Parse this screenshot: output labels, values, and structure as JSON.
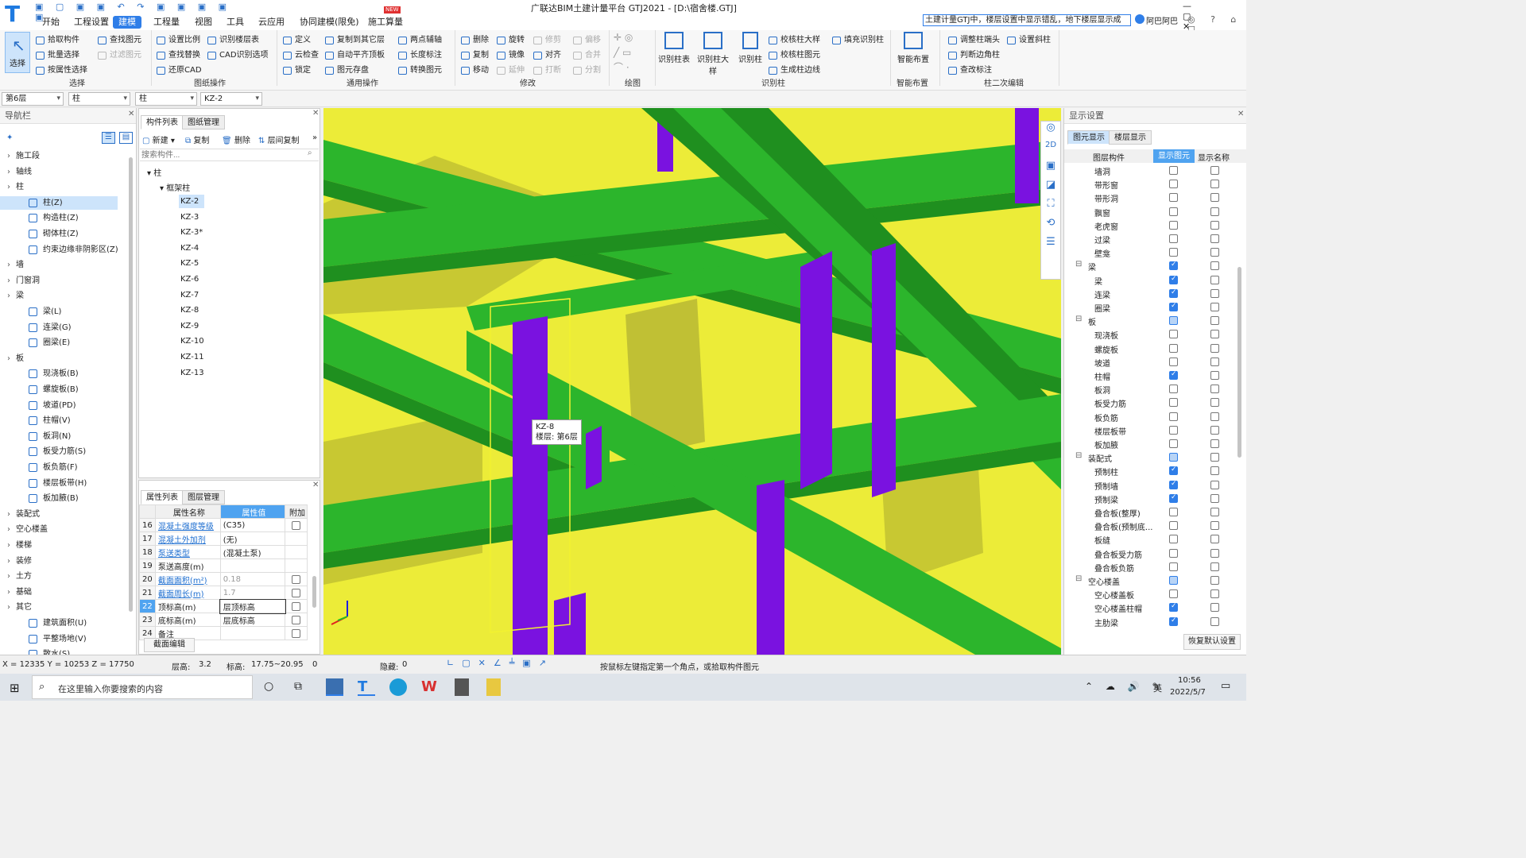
{
  "app": {
    "title": "广联达BIM土建计量平台 GTJ2021 - [D:\\宿舍楼.GTJ]",
    "logo_letter": "T",
    "new_badge": "NEW",
    "help_search": "土建计量GTJ中，楼层设置中显示错乱，地下楼层显示成",
    "user": "阿巴阿巴"
  },
  "menu_tabs": [
    "开始",
    "工程设置",
    "建模",
    "工程量",
    "视图",
    "工具",
    "云应用",
    "协同建模(限免)",
    "施工算量"
  ],
  "ribbon": {
    "select_big": "选择",
    "select_group": {
      "items": [
        "拾取构件",
        "批量选择",
        "按属性选择",
        "查找图元",
        "过滤图元"
      ],
      "label": "选择"
    },
    "drawing_ops": {
      "items": [
        "设置比例",
        "查找替换",
        "还原CAD",
        "识别楼层表",
        "CAD识别选项"
      ],
      "label": "图纸操作"
    },
    "common_ops": {
      "items": [
        "定义",
        "云检查",
        "锁定",
        "复制到其它层",
        "自动平齐顶板",
        "图元存盘",
        "两点辅轴",
        "长度标注",
        "转换图元"
      ],
      "label": "通用操作"
    },
    "modify": {
      "items": [
        "删除",
        "旋转",
        "修剪",
        "偏移",
        "复制",
        "镜像",
        "对齐",
        "合并",
        "移动",
        "延伸",
        "打断",
        "分割"
      ],
      "label": "修改"
    },
    "draw": {
      "label": "绘图"
    },
    "identify_col": {
      "bigs": [
        "识别柱表",
        "识别柱大样",
        "识别柱"
      ],
      "items": [
        "校核柱大样",
        "填充识别柱",
        "校核柱图元",
        "生成柱边线"
      ],
      "label": "识别柱"
    },
    "smart": {
      "big": "智能布置",
      "label": "智能布置"
    },
    "col_edit": {
      "items": [
        "调整柱端头",
        "设置斜柱",
        "判断边角柱",
        "查改标注"
      ],
      "label": "柱二次编辑"
    }
  },
  "filters": {
    "floor": "第6层",
    "type1": "柱",
    "type2": "柱",
    "component": "KZ-2"
  },
  "nav": {
    "title": "导航栏",
    "tree": [
      {
        "kind": "cat",
        "label": "施工段"
      },
      {
        "kind": "cat",
        "label": "轴线"
      },
      {
        "kind": "cat",
        "label": "柱"
      },
      {
        "kind": "item",
        "label": "柱(Z)",
        "selected": true
      },
      {
        "kind": "item",
        "label": "构造柱(Z)"
      },
      {
        "kind": "item",
        "label": "砌体柱(Z)"
      },
      {
        "kind": "item",
        "label": "约束边缘非阴影区(Z)"
      },
      {
        "kind": "cat",
        "label": "墙"
      },
      {
        "kind": "cat",
        "label": "门窗洞"
      },
      {
        "kind": "cat",
        "label": "梁"
      },
      {
        "kind": "item",
        "label": "梁(L)"
      },
      {
        "kind": "item",
        "label": "连梁(G)"
      },
      {
        "kind": "item",
        "label": "圈梁(E)"
      },
      {
        "kind": "cat",
        "label": "板"
      },
      {
        "kind": "item",
        "label": "现浇板(B)"
      },
      {
        "kind": "item",
        "label": "螺旋板(B)"
      },
      {
        "kind": "item",
        "label": "坡道(PD)"
      },
      {
        "kind": "item",
        "label": "柱帽(V)"
      },
      {
        "kind": "item",
        "label": "板洞(N)"
      },
      {
        "kind": "item",
        "label": "板受力筋(S)"
      },
      {
        "kind": "item",
        "label": "板负筋(F)"
      },
      {
        "kind": "item",
        "label": "楼层板带(H)"
      },
      {
        "kind": "item",
        "label": "板加腋(B)"
      },
      {
        "kind": "cat",
        "label": "装配式"
      },
      {
        "kind": "cat",
        "label": "空心楼盖"
      },
      {
        "kind": "cat",
        "label": "楼梯"
      },
      {
        "kind": "cat",
        "label": "装修"
      },
      {
        "kind": "cat",
        "label": "土方"
      },
      {
        "kind": "cat",
        "label": "基础"
      },
      {
        "kind": "cat",
        "label": "其它"
      },
      {
        "kind": "item",
        "label": "建筑面积(U)"
      },
      {
        "kind": "item",
        "label": "平整场地(V)"
      },
      {
        "kind": "item",
        "label": "散水(S)"
      }
    ]
  },
  "components": {
    "tabs": [
      "构件列表",
      "图纸管理"
    ],
    "toolbar": [
      "新建",
      "复制",
      "删除",
      "层间复制"
    ],
    "search_placeholder": "搜索构件...",
    "root": "柱",
    "group": "框架柱",
    "items": [
      "KZ-2",
      "KZ-3",
      "KZ-3*",
      "KZ-4",
      "KZ-5",
      "KZ-6",
      "KZ-7",
      "KZ-8",
      "KZ-9",
      "KZ-10",
      "KZ-11",
      "KZ-13"
    ],
    "selected": "KZ-2"
  },
  "properties": {
    "tabs": [
      "属性列表",
      "图层管理"
    ],
    "headers": [
      "属性名称",
      "属性值",
      "附加"
    ],
    "rows": [
      {
        "no": "16",
        "name": "混凝土强度等级",
        "value": "(C35)",
        "blue": true,
        "cb": true
      },
      {
        "no": "17",
        "name": "混凝土外加剂",
        "value": "(无)",
        "blue": true,
        "cb": false
      },
      {
        "no": "18",
        "name": "泵送类型",
        "value": "(混凝土泵)",
        "blue": true,
        "cb": false
      },
      {
        "no": "19",
        "name": "泵送高度(m)",
        "value": "",
        "blue": false,
        "cb": false
      },
      {
        "no": "20",
        "name": "截面面积(m²)",
        "value": "0.18",
        "blue": true,
        "cb": true,
        "gray": true
      },
      {
        "no": "21",
        "name": "截面周长(m)",
        "value": "1.7",
        "blue": true,
        "cb": true,
        "gray": true
      },
      {
        "no": "22",
        "name": "顶标高(m)",
        "value": "层顶标高",
        "blue": false,
        "cb": true,
        "active": true
      },
      {
        "no": "23",
        "name": "底标高(m)",
        "value": "层底标高",
        "blue": false,
        "cb": true
      },
      {
        "no": "24",
        "name": "备注",
        "value": "",
        "blue": false,
        "cb": true
      }
    ],
    "button": "截面编辑"
  },
  "viewport": {
    "tooltip": [
      "KZ-8",
      "楼层: 第6层"
    ],
    "colors": {
      "slab": "#ecec38",
      "beam": "#2cb52c",
      "beam_dark": "#1f8f1f",
      "column": "#7a12e0",
      "wall": "#c8c832"
    }
  },
  "display": {
    "title": "显示设置",
    "tabs": [
      "图元显示",
      "楼层显示"
    ],
    "headers": [
      "图层构件",
      "显示图元",
      "显示名称"
    ],
    "rows": [
      {
        "l": "墙洞",
        "lv": 2,
        "a": 0,
        "b": 0
      },
      {
        "l": "带形窗",
        "lv": 2,
        "a": 0,
        "b": 0
      },
      {
        "l": "带形洞",
        "lv": 2,
        "a": 0,
        "b": 0
      },
      {
        "l": "飘窗",
        "lv": 2,
        "a": 0,
        "b": 0
      },
      {
        "l": "老虎窗",
        "lv": 2,
        "a": 0,
        "b": 0
      },
      {
        "l": "过梁",
        "lv": 2,
        "a": 0,
        "b": 0
      },
      {
        "l": "壁龛",
        "lv": 2,
        "a": 0,
        "b": 0
      },
      {
        "l": "梁",
        "lv": 1,
        "a": 1,
        "b": 0
      },
      {
        "l": "梁",
        "lv": 2,
        "a": 1,
        "b": 0
      },
      {
        "l": "连梁",
        "lv": 2,
        "a": 1,
        "b": 0
      },
      {
        "l": "圈梁",
        "lv": 2,
        "a": 1,
        "b": 0
      },
      {
        "l": "板",
        "lv": 1,
        "a": 2,
        "b": 0
      },
      {
        "l": "现浇板",
        "lv": 2,
        "a": 0,
        "b": 0
      },
      {
        "l": "螺旋板",
        "lv": 2,
        "a": 0,
        "b": 0
      },
      {
        "l": "坡道",
        "lv": 2,
        "a": 0,
        "b": 0
      },
      {
        "l": "柱帽",
        "lv": 2,
        "a": 1,
        "b": 0
      },
      {
        "l": "板洞",
        "lv": 2,
        "a": 0,
        "b": 0
      },
      {
        "l": "板受力筋",
        "lv": 2,
        "a": 0,
        "b": 0
      },
      {
        "l": "板负筋",
        "lv": 2,
        "a": 0,
        "b": 0
      },
      {
        "l": "楼层板带",
        "lv": 2,
        "a": 0,
        "b": 0
      },
      {
        "l": "板加腋",
        "lv": 2,
        "a": 0,
        "b": 0
      },
      {
        "l": "装配式",
        "lv": 1,
        "a": 2,
        "b": 0
      },
      {
        "l": "预制柱",
        "lv": 2,
        "a": 1,
        "b": 0
      },
      {
        "l": "预制墙",
        "lv": 2,
        "a": 1,
        "b": 0
      },
      {
        "l": "预制梁",
        "lv": 2,
        "a": 1,
        "b": 0
      },
      {
        "l": "叠合板(整厚)",
        "lv": 2,
        "a": 0,
        "b": 0
      },
      {
        "l": "叠合板(预制底...",
        "lv": 2,
        "a": 0,
        "b": 0
      },
      {
        "l": "板缝",
        "lv": 2,
        "a": 0,
        "b": 0
      },
      {
        "l": "叠合板受力筋",
        "lv": 2,
        "a": 0,
        "b": 0
      },
      {
        "l": "叠合板负筋",
        "lv": 2,
        "a": 0,
        "b": 0
      },
      {
        "l": "空心楼盖",
        "lv": 1,
        "a": 2,
        "b": 0
      },
      {
        "l": "空心楼盖板",
        "lv": 2,
        "a": 0,
        "b": 0
      },
      {
        "l": "空心楼盖柱帽",
        "lv": 2,
        "a": 1,
        "b": 0
      },
      {
        "l": "主肋梁",
        "lv": 2,
        "a": 1,
        "b": 0
      }
    ],
    "button": "恢复默认设置"
  },
  "status": {
    "coords": "X = 12335 Y = 10253 Z = 17750",
    "floor_height_label": "层高:",
    "floor_height": "3.2",
    "elev_label": "标高:",
    "elev": "17.75~20.95",
    "zero": "0",
    "hidden_label": "隐藏:",
    "hidden": "0",
    "hint": "按鼠标左键指定第一个角点，或拾取构件图元"
  },
  "taskbar": {
    "search": "在这里输入你要搜索的内容",
    "time": "10:56",
    "date": "2022/5/7",
    "ime": "英"
  }
}
